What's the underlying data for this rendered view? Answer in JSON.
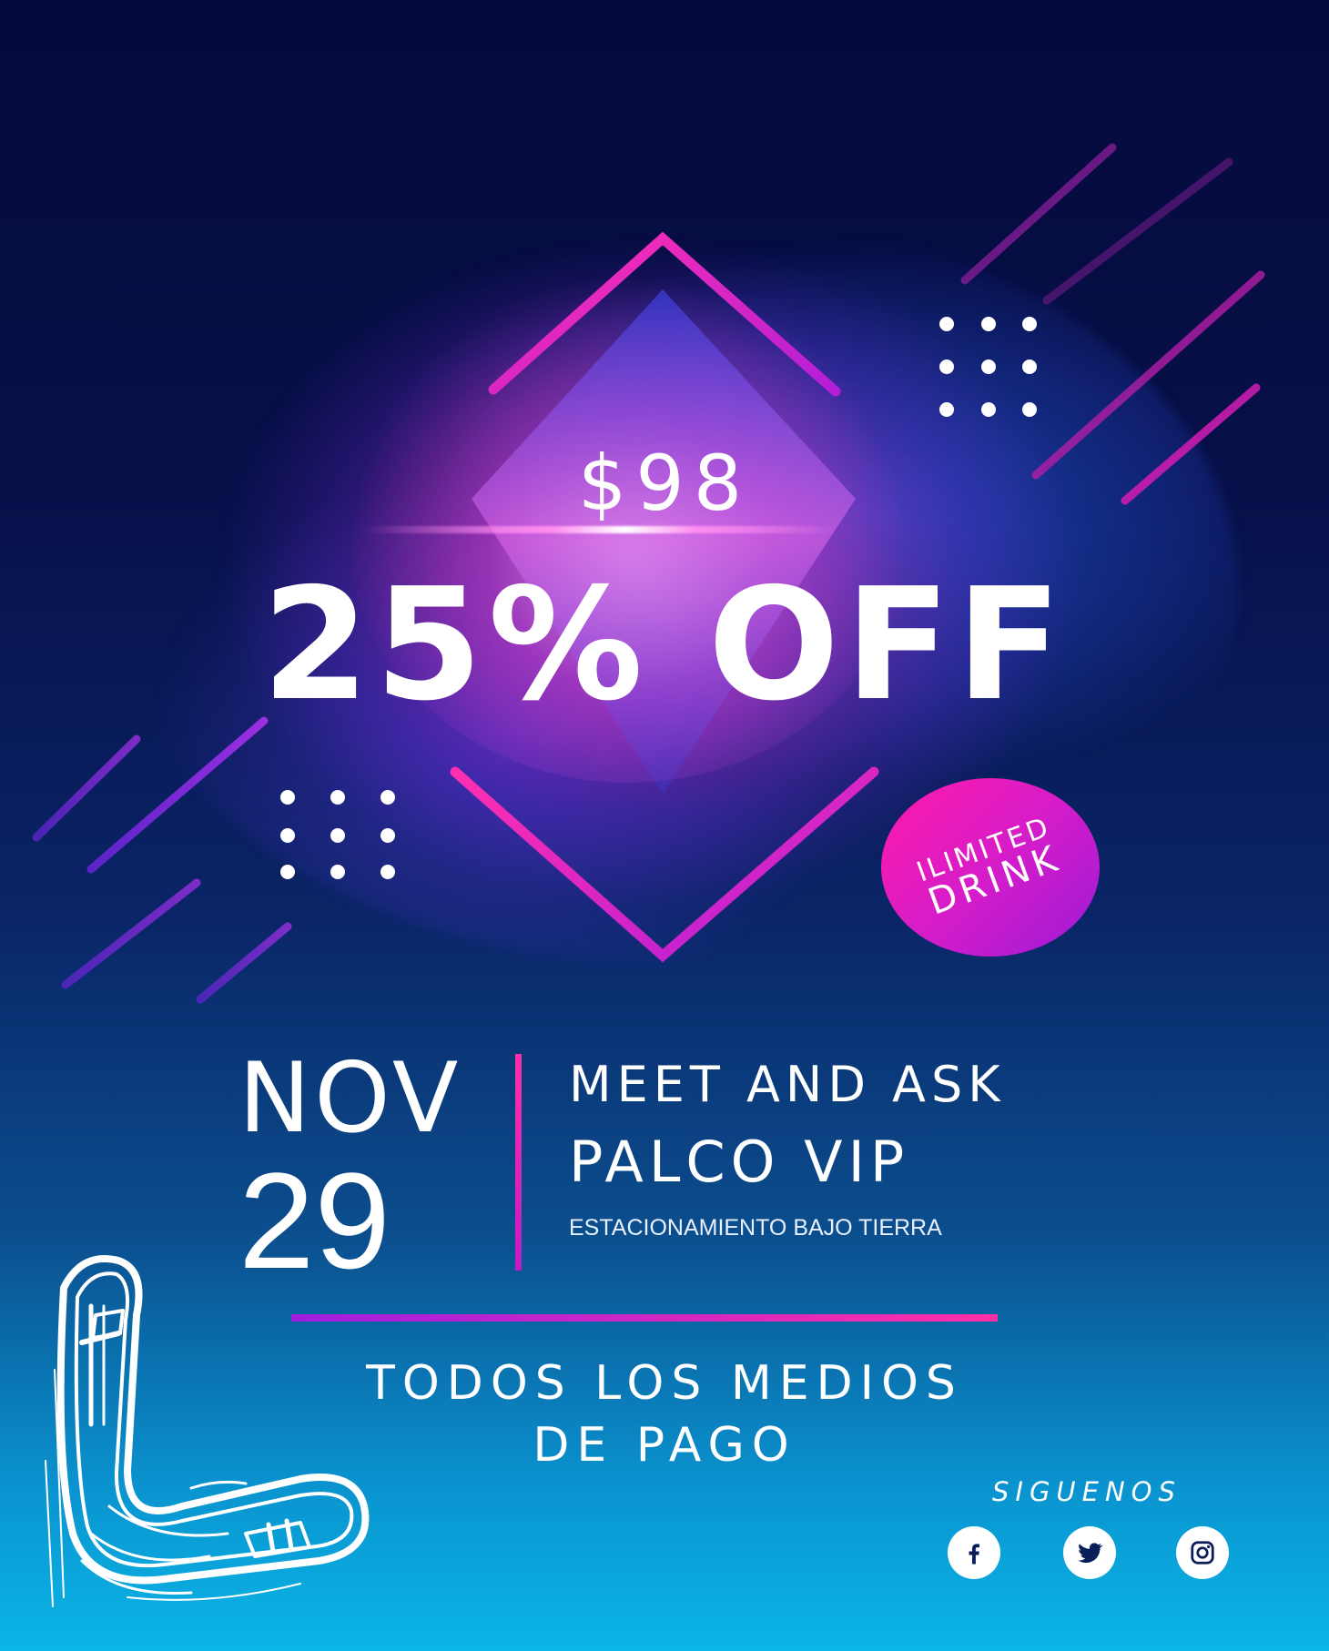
{
  "promo": {
    "price": "$98",
    "headline": "25% OFF",
    "badge_line1": "ILIMITED",
    "badge_line2": "DRINK"
  },
  "event": {
    "month": "NOV",
    "day": "29",
    "title": "MEET AND ASK",
    "subtitle": "PALCO VIP",
    "location": "ESTACIONAMIENTO BAJO TIERRA"
  },
  "payment": {
    "line1": "TODOS LOS MEDIOS",
    "line2": "DE PAGO"
  },
  "social": {
    "label": "SIGUENOS",
    "icons": [
      "facebook-icon",
      "twitter-icon",
      "instagram-icon"
    ]
  },
  "colors": {
    "background_top": "#050a3c",
    "background_bottom": "#0bb6e6",
    "accent_pink": "#ff2fa8",
    "accent_purple": "#a01ee0",
    "text": "#ffffff",
    "icon_dark": "#0a1e5a"
  }
}
